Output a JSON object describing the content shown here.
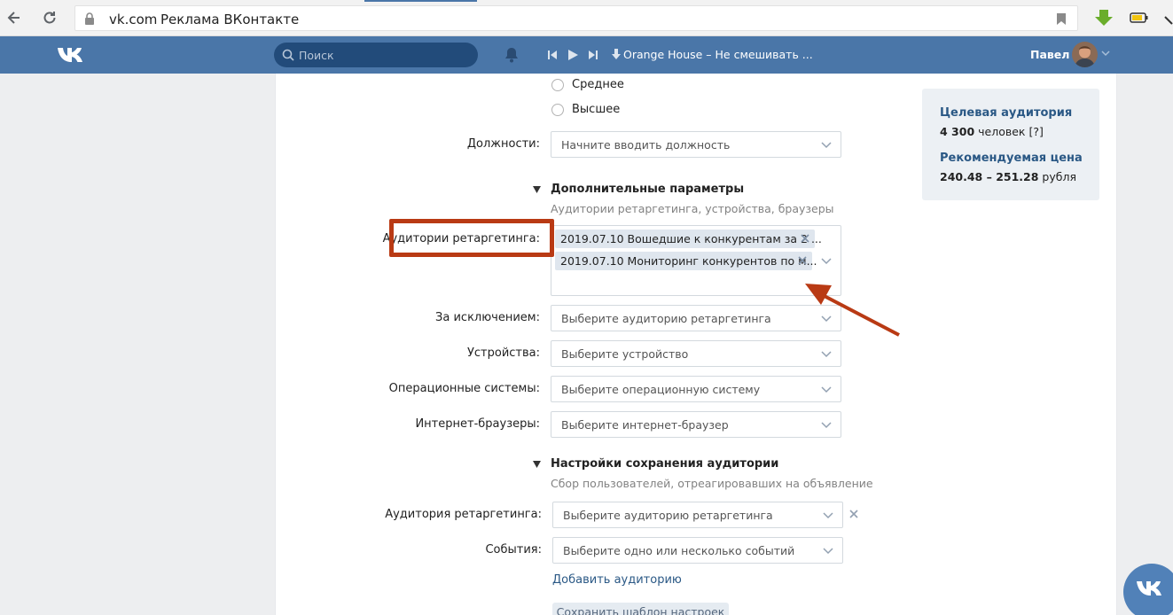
{
  "browser": {
    "domain": "vk.com",
    "page_title": "Реклама ВКонтакте"
  },
  "header": {
    "search_placeholder": "Поиск",
    "track": "Orange House – Не смешивать ...",
    "user_name": "Павел"
  },
  "education": {
    "options": [
      "Среднее",
      "Высшее"
    ]
  },
  "positions": {
    "label": "Должности:",
    "placeholder": "Начните вводить должность"
  },
  "extra_params": {
    "title": "Дополнительные параметры",
    "subtitle": "Аудитории ретаргетинга, устройства, браузеры",
    "retargeting_label": "Аудитории ретаргетинга:",
    "retargeting_tokens": [
      "2019.07.10 Вошедшие к конкурентам за 2 ...",
      "2019.07.10 Мониторинг конкурентов по м..."
    ],
    "except_label": "За исключением:",
    "except_placeholder": "Выберите аудиторию ретаргетинга",
    "devices_label": "Устройства:",
    "devices_placeholder": "Выберите устройство",
    "os_label": "Операционные системы:",
    "os_placeholder": "Выберите операционную систему",
    "browsers_label": "Интернет-браузеры:",
    "browsers_placeholder": "Выберите интернет-браузер"
  },
  "save_audience": {
    "title": "Настройки сохранения аудитории",
    "subtitle": "Сбор пользователей, отреагировавших на объявление",
    "audience_label": "Аудитория ретаргетинга:",
    "audience_placeholder": "Выберите аудиторию ретаргетинга",
    "events_label": "События:",
    "events_placeholder": "Выберите одно или несколько событий",
    "add_link": "Добавить аудиторию",
    "save_button": "Сохранить шаблон настроек"
  },
  "summary": {
    "audience_title": "Целевая аудитория",
    "audience_count": "4 300",
    "audience_unit": "человек",
    "audience_help": "[?]",
    "price_title": "Рекомендуемая цена",
    "price_range": "240.48 – 251.28",
    "price_unit": "рубля"
  },
  "colors": {
    "vk_blue": "#4a76a8",
    "highlight": "#b93a14"
  }
}
